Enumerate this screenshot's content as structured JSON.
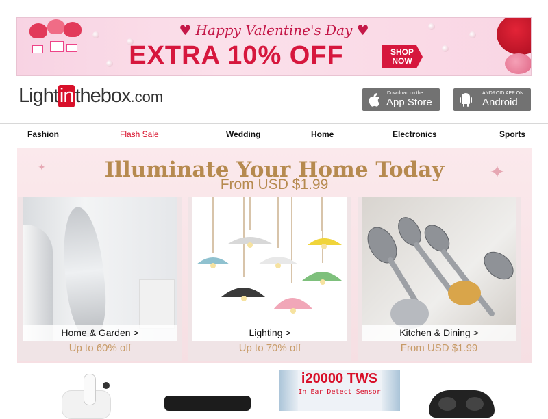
{
  "banner": {
    "title": "♥ Happy Valentine's Day ♥",
    "headline_left": "EXTRA 10% OFF",
    "shop_now_line1": "SHOP",
    "shop_now_line2": "NOW"
  },
  "logo": {
    "part1": "Light",
    "part2": "in",
    "part3": "thebox",
    "part4": ".com"
  },
  "apps": {
    "appstore_small": "Download on the",
    "appstore_big": "App Store",
    "android_small": "ANDROID APP ON",
    "android_big": "Android"
  },
  "nav": {
    "items": [
      "Fashion",
      "Flash Sale",
      "Wedding",
      "Home",
      "Electronics",
      "Sports"
    ],
    "highlight_color": "#d8102a"
  },
  "promo": {
    "title": "Illuminate Your Home Today",
    "subtitle": "From USD $1.99",
    "cards": [
      {
        "label": "Home & Garden >",
        "offer": "Up to 60% off"
      },
      {
        "label": "Lighting >",
        "offer": "Up to 70% off"
      },
      {
        "label": "Kitchen & Dining >",
        "offer": "From USD $1.99"
      }
    ]
  },
  "products": {
    "earbud_title": "i20000 TWS",
    "earbud_sub": "In Ear Detect Sensor"
  },
  "colors": {
    "brand_red": "#d8102a",
    "promo_gold": "#b68a4f",
    "app_button_gray": "#727272"
  }
}
